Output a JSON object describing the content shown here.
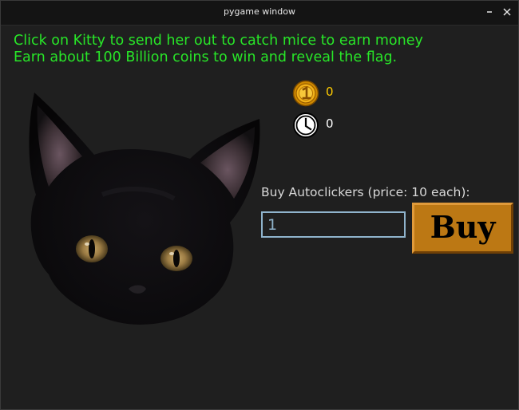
{
  "window": {
    "title": "pygame window"
  },
  "instructions": {
    "line1": "Click on Kitty to send her out to catch mice to earn money",
    "line2": "Earn about 100 Billion coins to win and reveal the flag."
  },
  "stats": {
    "coins": "0",
    "autoclickers": "0",
    "coin_icon": "coin-1-icon",
    "clock_icon": "clock-icon"
  },
  "shop": {
    "label": "Buy Autoclickers (price: 10 each):",
    "quantity_value": "1",
    "buy_label": "Buy"
  },
  "colors": {
    "background": "#1f1f1f",
    "instruction_text": "#28e628",
    "coin_text": "#ffcc00",
    "buy_button": "#bc7814",
    "input_border": "#8fb3cc"
  }
}
